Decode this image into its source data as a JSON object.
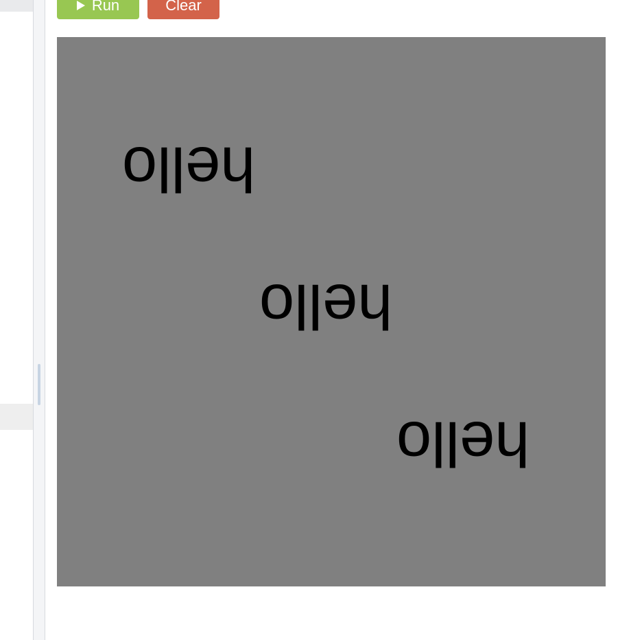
{
  "toolbar": {
    "run_label": "Run",
    "clear_label": "Clear",
    "run_icon": "play-icon",
    "run_color": "#98c752",
    "clear_color": "#d3634a"
  },
  "canvas": {
    "background": "#808080",
    "texts": [
      "hello",
      "hello",
      "hello"
    ],
    "text_rotation_degrees": 180
  }
}
